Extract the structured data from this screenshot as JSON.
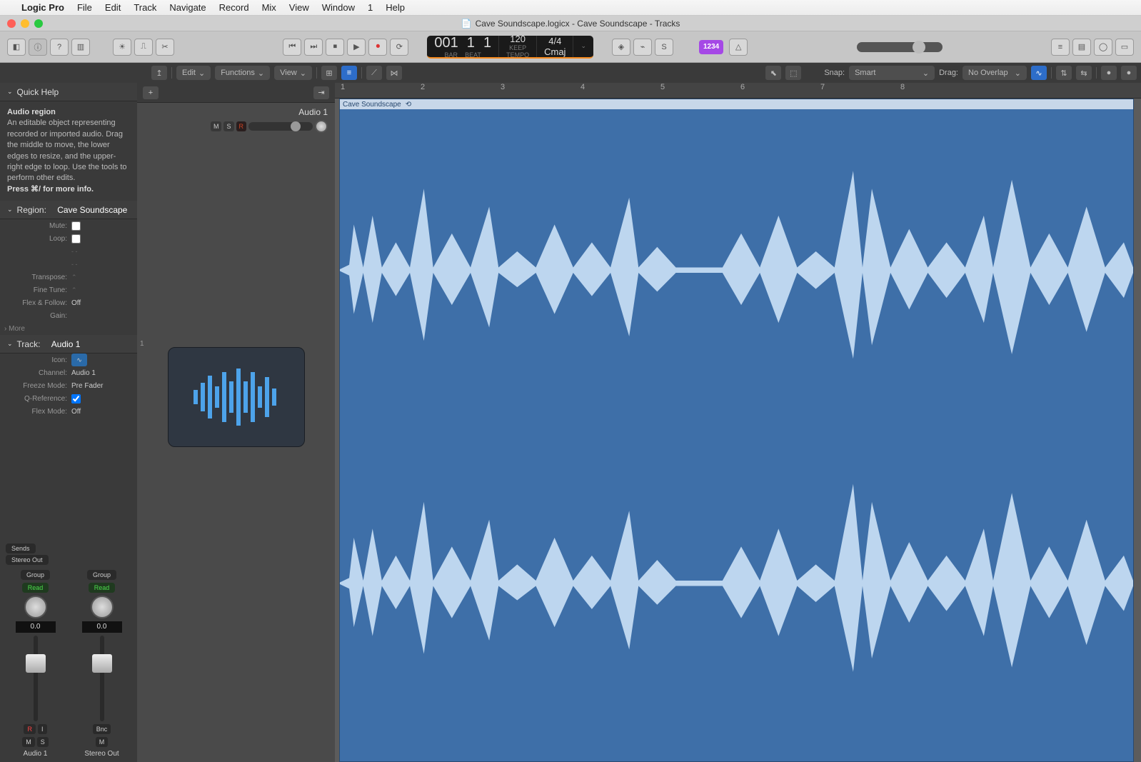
{
  "menu": {
    "items": [
      "Logic Pro",
      "File",
      "Edit",
      "Track",
      "Navigate",
      "Record",
      "Mix",
      "View",
      "Window",
      "1",
      "Help"
    ]
  },
  "window": {
    "title": "Cave Soundscape.logicx - Cave Soundscape - Tracks"
  },
  "lcd": {
    "bar": "001",
    "beat_a": "1",
    "beat_b": "1",
    "barlab": "BAR",
    "beatlab": "BEAT",
    "tempo": "120",
    "keep": "KEEP",
    "tempolab": "TEMPO",
    "sig": "4/4",
    "key": "Cmaj"
  },
  "tbar": {
    "edit": "Edit",
    "functions": "Functions",
    "view": "View",
    "snap_label": "Snap:",
    "snap_val": "Smart",
    "drag_label": "Drag:",
    "drag_val": "No Overlap"
  },
  "badge": "1234",
  "inspector": {
    "quickhelp": {
      "title": "Quick Help",
      "hdr": "Audio region",
      "body": "An editable object representing recorded or imported audio. Drag the middle to move, the lower edges to resize, and the upper-right edge to loop. Use the tools to perform other edits.",
      "press": "Press ⌘/ for more info."
    },
    "region": {
      "title": "Region:",
      "name": "Cave Soundscape",
      "mute": "Mute:",
      "loop": "Loop:",
      "transpose": "Transpose:",
      "finetune": "Fine Tune:",
      "flexfollow": "Flex & Follow:",
      "flexfollow_val": "Off",
      "gain": "Gain:",
      "more": "More"
    },
    "track": {
      "title": "Track:",
      "name": "Audio 1",
      "icon": "Icon:",
      "channel": "Channel:",
      "channel_val": "Audio 1",
      "freeze": "Freeze Mode:",
      "freeze_val": "Pre Fader",
      "qref": "Q-Reference:",
      "flex": "Flex Mode:",
      "flex_val": "Off"
    },
    "mixer": {
      "sends": "Sends",
      "stereo": "Stereo Out",
      "group": "Group",
      "read": "Read",
      "db": "0.0",
      "names": [
        "Audio 1",
        "Stereo Out"
      ],
      "R": "R",
      "I": "I",
      "M": "M",
      "S": "S",
      "Bnc": "Bnc"
    }
  },
  "tracks": {
    "name": "Audio 1",
    "M": "M",
    "S": "S",
    "R": "R",
    "num": "1"
  },
  "ruler": [
    1,
    2,
    3,
    4,
    5,
    6,
    7,
    8
  ],
  "region": {
    "name": "Cave Soundscape"
  }
}
